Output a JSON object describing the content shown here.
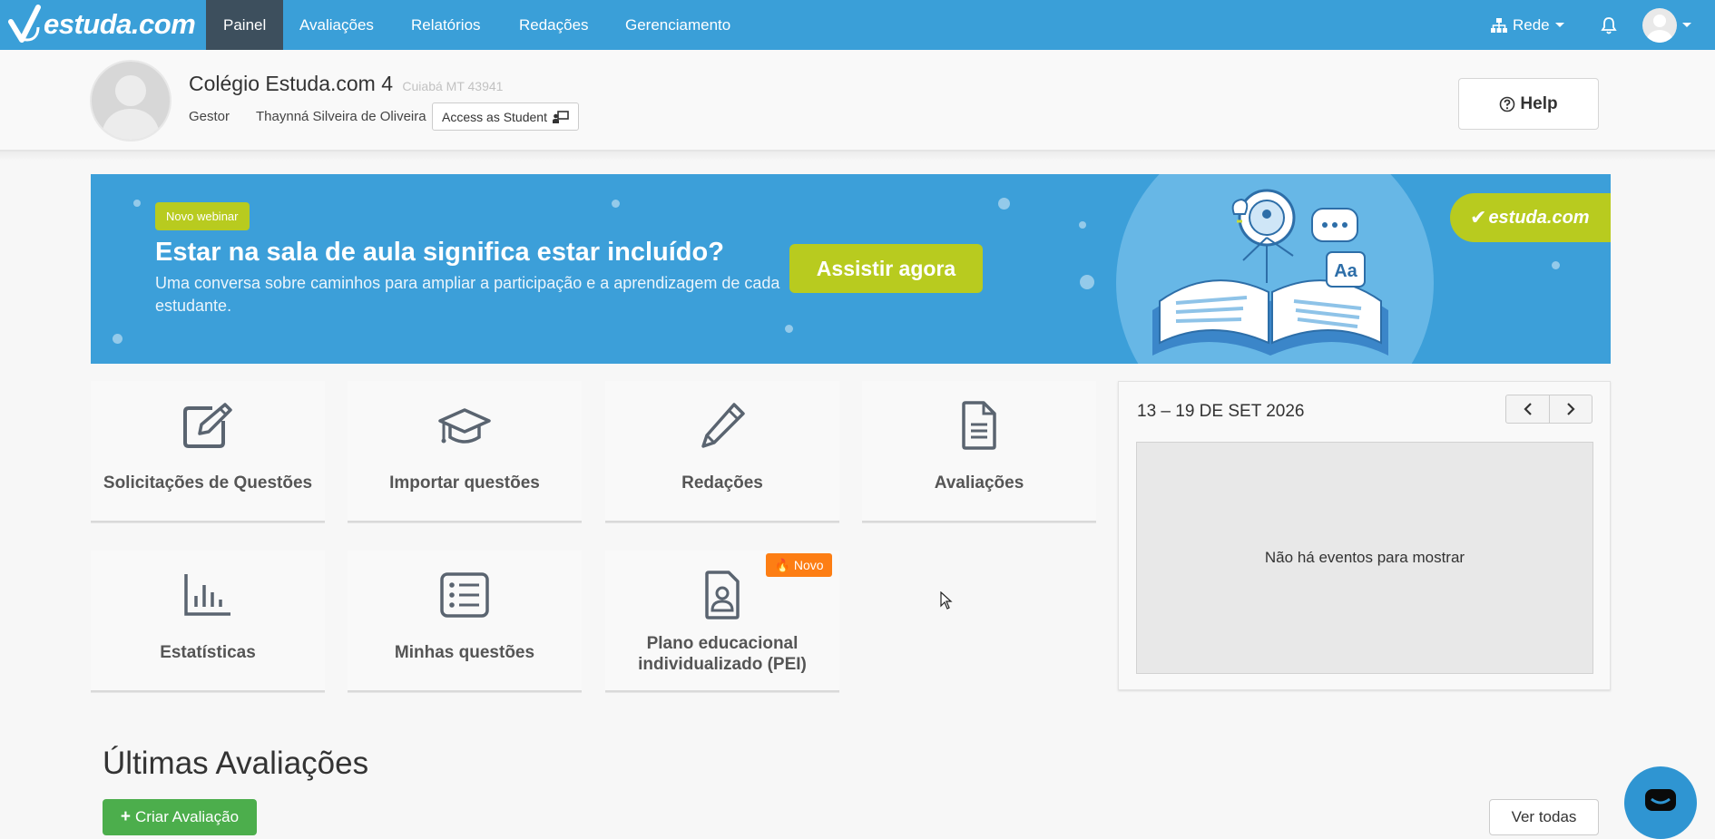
{
  "brand": {
    "name": "estuda.com"
  },
  "nav": {
    "items": [
      {
        "label": "Painel",
        "active": true
      },
      {
        "label": "Avaliações"
      },
      {
        "label": "Relatórios"
      },
      {
        "label": "Redações"
      },
      {
        "label": "Gerenciamento"
      }
    ],
    "network_label": "Rede"
  },
  "school": {
    "name": "Colégio Estuda.com 4",
    "location": "Cuiabá MT 43941",
    "role": "Gestor",
    "user": "Thaynná Silveira de Oliveira",
    "access_label": "Access as Student"
  },
  "help_label": "Help",
  "banner": {
    "badge": "Novo webinar",
    "title": "Estar na sala de aula significa estar incluído?",
    "subtitle": "Uma conversa sobre caminhos para ampliar a participação e a aprendizagem de cada estudante.",
    "cta": "Assistir agora",
    "brand": "estuda.com",
    "illustration_text": "Aa"
  },
  "shortcuts": [
    {
      "label": "Solicitações de Questões",
      "icon": "edit-square-icon"
    },
    {
      "label": "Importar questões",
      "icon": "graduation-cap-icon"
    },
    {
      "label": "Redações",
      "icon": "pencil-icon"
    },
    {
      "label": "Avaliações",
      "icon": "document-icon"
    },
    {
      "label": "Estatísticas",
      "icon": "bar-chart-icon"
    },
    {
      "label": "Minhas questões",
      "icon": "list-icon"
    },
    {
      "label": "Plano educacional individualizado (PEI)",
      "icon": "id-card-icon",
      "badge": "Novo"
    }
  ],
  "calendar": {
    "range": "13 – 19 DE SET 2026",
    "empty_message": "Não há eventos para mostrar"
  },
  "latest": {
    "title": "Últimas Avaliações",
    "create_label": "Criar Avaliação",
    "view_all_label": "Ver todas"
  },
  "colors": {
    "navbar": "#3a9fd8",
    "nav_active": "#3d4f5d",
    "banner": "#3c9fd9",
    "accent_lime": "#b8cb1f",
    "badge_orange": "#fd7e14",
    "create_green": "#4cae4c"
  }
}
